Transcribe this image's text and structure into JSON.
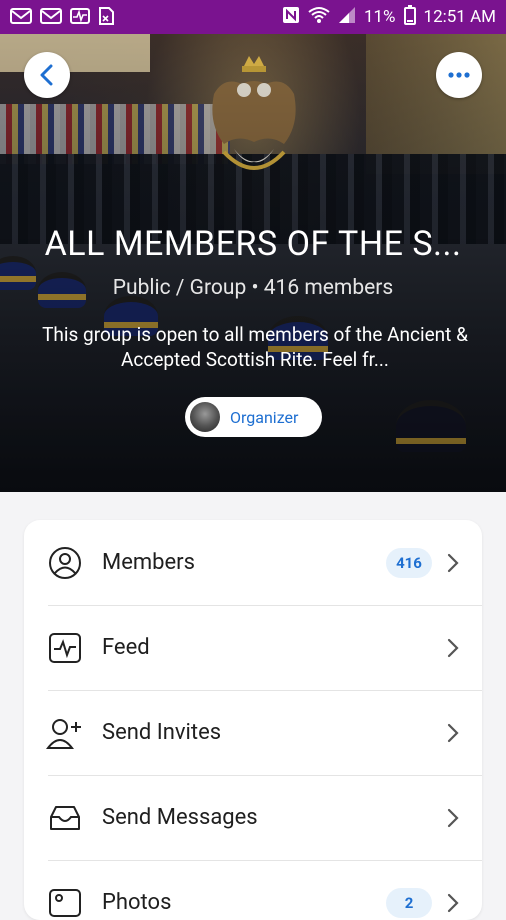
{
  "status_bar": {
    "battery_pct": "11%",
    "time": "12:51 AM",
    "left_icons": [
      "gmail-icon",
      "gmail-icon",
      "activity-icon",
      "document-icon"
    ],
    "right_icons": [
      "nfc-icon",
      "wifi-icon",
      "signal-icon",
      "battery-icon"
    ]
  },
  "header": {
    "back_icon": "back-arrow-icon",
    "more_icon": "more-dots-icon"
  },
  "group": {
    "title": "ALL MEMBERS OF THE S...",
    "subtitle": "Public / Group • 416 members",
    "description": "This group is open to all members of the Ancient & Accepted Scottish Rite. Feel fr...",
    "organizer_label": "Organizer"
  },
  "menu": {
    "items": [
      {
        "label": "Members",
        "icon": "person-circle-icon",
        "badge": "416"
      },
      {
        "label": "Feed",
        "icon": "activity-feed-icon"
      },
      {
        "label": "Send Invites",
        "icon": "add-person-icon"
      },
      {
        "label": "Send Messages",
        "icon": "inbox-icon"
      },
      {
        "label": "Photos",
        "icon": "photo-icon",
        "badge": "2"
      }
    ]
  },
  "colors": {
    "status_bar": "#7a138f",
    "accent": "#1e6fd1",
    "badge_bg": "#e6f1fb"
  }
}
